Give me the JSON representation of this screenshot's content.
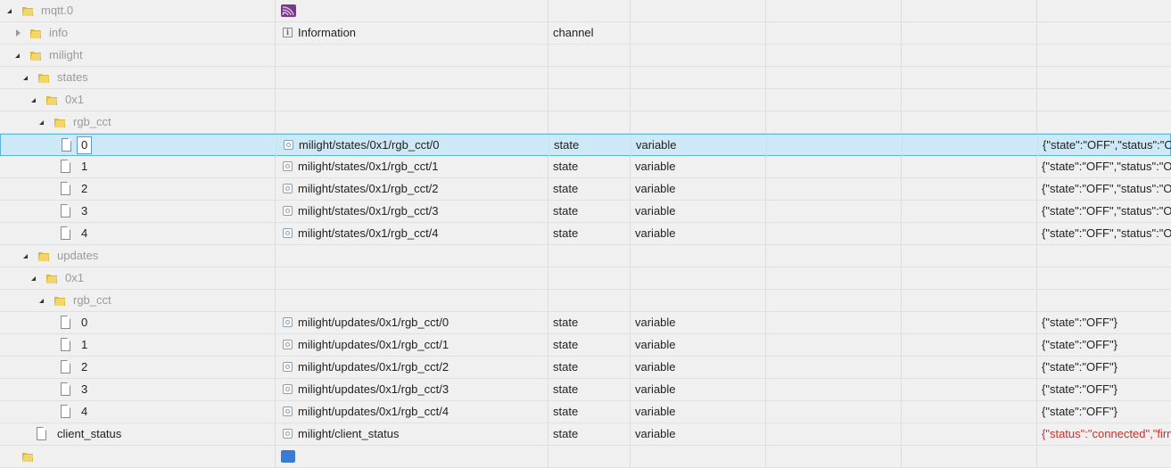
{
  "columns": {
    "type_state": "state",
    "role_variable": "variable"
  },
  "rows": [
    {
      "label": "mqtt.0",
      "name": "",
      "type": "",
      "role": "",
      "value": ""
    },
    {
      "label": "info",
      "name": "Information",
      "type": "channel",
      "role": "",
      "value": ""
    },
    {
      "label": "milight",
      "name": "",
      "type": "",
      "role": "",
      "value": ""
    },
    {
      "label": "states",
      "name": "",
      "type": "",
      "role": "",
      "value": ""
    },
    {
      "label": "0x1",
      "name": "",
      "type": "",
      "role": "",
      "value": ""
    },
    {
      "label": "rgb_cct",
      "name": "",
      "type": "",
      "role": "",
      "value": ""
    },
    {
      "label": "0",
      "name": "milight/states/0x1/rgb_cct/0",
      "type": "state",
      "role": "variable",
      "value": "{\"state\":\"OFF\",\"status\":\"ON\"}"
    },
    {
      "label": "1",
      "name": "milight/states/0x1/rgb_cct/1",
      "type": "state",
      "role": "variable",
      "value": "{\"state\":\"OFF\",\"status\":\"ON\"}"
    },
    {
      "label": "2",
      "name": "milight/states/0x1/rgb_cct/2",
      "type": "state",
      "role": "variable",
      "value": "{\"state\":\"OFF\",\"status\":\"ON\"}"
    },
    {
      "label": "3",
      "name": "milight/states/0x1/rgb_cct/3",
      "type": "state",
      "role": "variable",
      "value": "{\"state\":\"OFF\",\"status\":\"ON\"}"
    },
    {
      "label": "4",
      "name": "milight/states/0x1/rgb_cct/4",
      "type": "state",
      "role": "variable",
      "value": "{\"state\":\"OFF\",\"status\":\"ON\"}"
    },
    {
      "label": "updates",
      "name": "",
      "type": "",
      "role": "",
      "value": ""
    },
    {
      "label": "0x1",
      "name": "",
      "type": "",
      "role": "",
      "value": ""
    },
    {
      "label": "rgb_cct",
      "name": "",
      "type": "",
      "role": "",
      "value": ""
    },
    {
      "label": "0",
      "name": "milight/updates/0x1/rgb_cct/0",
      "type": "state",
      "role": "variable",
      "value": "{\"state\":\"OFF\"}"
    },
    {
      "label": "1",
      "name": "milight/updates/0x1/rgb_cct/1",
      "type": "state",
      "role": "variable",
      "value": "{\"state\":\"OFF\"}"
    },
    {
      "label": "2",
      "name": "milight/updates/0x1/rgb_cct/2",
      "type": "state",
      "role": "variable",
      "value": "{\"state\":\"OFF\"}"
    },
    {
      "label": "3",
      "name": "milight/updates/0x1/rgb_cct/3",
      "type": "state",
      "role": "variable",
      "value": "{\"state\":\"OFF\"}"
    },
    {
      "label": "4",
      "name": "milight/updates/0x1/rgb_cct/4",
      "type": "state",
      "role": "variable",
      "value": "{\"state\":\"OFF\"}"
    },
    {
      "label": "client_status",
      "name": "milight/client_status",
      "type": "state",
      "role": "variable",
      "value": "{\"status\":\"connected\",\"firmware\"}"
    }
  ],
  "colors": {
    "selected_bg": "#cde8f6",
    "selected_border": "#5cb4de",
    "folder": "#e8c74a",
    "value_red": "#c8302a"
  }
}
